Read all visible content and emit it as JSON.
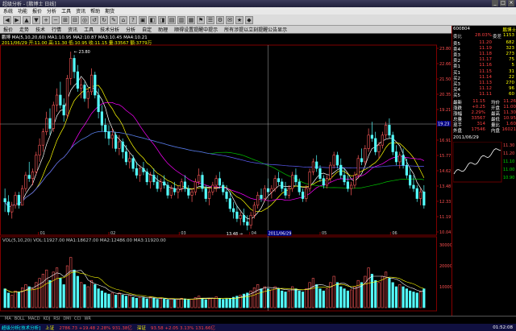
{
  "window": {
    "title": "超级分析 - [鹏博士 日线]"
  },
  "menu": [
    "系统",
    "功能",
    "报价",
    "分析",
    "工具",
    "资讯",
    "帮助",
    "期货"
  ],
  "toolbar2": [
    "报价",
    "走势",
    "技术",
    "行情",
    "资讯",
    "工具",
    "技术分析",
    "分析",
    "自定",
    "助理",
    "顺得设置提醒中提示",
    "所有涉提以立刻提醒公告显示"
  ],
  "stock": {
    "name": "鹏博士",
    "code": "600804"
  },
  "main_info": {
    "line1": "鹏博 MA(5,10,20,60) MA1:10.95 MA2:10.87 MA3:10.45 MA4:10.21",
    "line2": "2011/06/29 开:11.00 高:11.30 低:10.95 收:11.15 量:33567 额:3779万"
  },
  "vol_info": "VOL(5,10,20) VOL:11927.00 MA1:18627.00 MA2:12486.00 MA3:11920.00",
  "price_labels": [
    "22.50",
    "21.00",
    "19.50",
    "18.00",
    "16.50",
    "15.00"
  ],
  "y_axis": [
    "23.80",
    "22.66",
    "21.50",
    "20.35",
    "19.21",
    "18.06",
    "16.91",
    "15.77",
    "14.62",
    "13.48",
    "12.33",
    "11.19",
    "10.04"
  ],
  "vol_axis": [
    "30000",
    "20000",
    "10000"
  ],
  "marks": {
    "high": "23.80",
    "low": "13.48"
  },
  "date_labels": [
    "01",
    "02",
    "03",
    "04",
    "05",
    "06"
  ],
  "crosshair": {
    "date": "2011/06/29",
    "value": "19.23"
  },
  "rpanel": {
    "code": "600804",
    "name": "鹏博士",
    "ratio_label": "委比",
    "ratio": "28.03%",
    "diff_label": "委差",
    "diff": "1153",
    "asks": [
      {
        "l": "卖5",
        "p": "11.20",
        "v": "682"
      },
      {
        "l": "卖4",
        "p": "11.19",
        "v": "323"
      },
      {
        "l": "卖3",
        "p": "11.18",
        "v": "273"
      },
      {
        "l": "卖2",
        "p": "11.17",
        "v": "75"
      },
      {
        "l": "卖1",
        "p": "11.16",
        "v": "5"
      }
    ],
    "bids": [
      {
        "l": "买1",
        "p": "11.15",
        "v": "31"
      },
      {
        "l": "买2",
        "p": "11.14",
        "v": "22"
      },
      {
        "l": "买3",
        "p": "11.13",
        "v": "270"
      },
      {
        "l": "买4",
        "p": "11.12",
        "v": "96"
      },
      {
        "l": "买5",
        "p": "11.11",
        "v": "60"
      }
    ],
    "stats": [
      {
        "a": "最新",
        "b": "11.15",
        "c": "均价",
        "d": "11.26"
      },
      {
        "a": "涨跌",
        "b": "+0.25",
        "c": "开盘",
        "d": "11.00"
      },
      {
        "a": "涨幅",
        "b": "2.29%",
        "c": "最高",
        "d": "11.30"
      },
      {
        "a": "总量",
        "b": "33567",
        "c": "最低",
        "d": "10.95"
      },
      {
        "a": "现手",
        "b": "314",
        "c": "量比",
        "d": "1.60"
      },
      {
        "a": "外盘",
        "b": "17546",
        "c": "内盘",
        "d": "16021"
      }
    ],
    "mini_date": "2011/06/29",
    "mini_values": [
      "11.30",
      "11.20",
      "11.10",
      "11.00",
      "10.90"
    ]
  },
  "tabs": [
    "MA",
    "BOLL",
    "MACD",
    "KDJ",
    "RSI",
    "DMI",
    "CCI",
    "WR"
  ],
  "status": {
    "brand": "超级分析[技术分析]",
    "index1_name": "上证",
    "index1": "2786.73 +19.48 2.28% 931.38亿",
    "index2_name": "深证",
    "index2": "93.58 +2.05 3.13% 131.66亿",
    "time": "01:52:08"
  },
  "colors": {
    "up": "#ff5a5a",
    "down": "#54ffff",
    "ma5": "#ffffff",
    "ma10": "#ffff00",
    "ma20": "#ff00ff",
    "ma60": "#00c000",
    "ma120": "#6060ff"
  },
  "chart_data": {
    "type": "candlestick",
    "candles": [
      [
        15.0,
        15.6,
        14.2,
        14.8
      ],
      [
        14.8,
        15.2,
        14.0,
        14.2
      ],
      [
        14.2,
        14.8,
        13.8,
        14.6
      ],
      [
        14.6,
        15.4,
        14.4,
        15.2
      ],
      [
        15.2,
        15.4,
        14.4,
        14.6
      ],
      [
        14.6,
        15.8,
        14.6,
        15.6
      ],
      [
        15.6,
        16.6,
        15.4,
        16.4
      ],
      [
        16.4,
        17.2,
        16.0,
        16.2
      ],
      [
        16.2,
        16.8,
        15.8,
        16.6
      ],
      [
        16.6,
        17.8,
        16.4,
        17.6
      ],
      [
        17.6,
        18.6,
        17.2,
        18.2
      ],
      [
        18.2,
        19.2,
        17.8,
        19.0
      ],
      [
        19.0,
        20.2,
        18.8,
        19.8
      ],
      [
        19.8,
        20.4,
        18.8,
        19.2
      ],
      [
        19.2,
        20.8,
        19.0,
        20.6
      ],
      [
        20.6,
        21.6,
        20.2,
        21.2
      ],
      [
        21.2,
        22.0,
        20.4,
        20.6
      ],
      [
        20.6,
        21.0,
        19.6,
        20.0
      ],
      [
        20.0,
        22.4,
        19.8,
        22.2
      ],
      [
        22.2,
        23.8,
        21.8,
        23.4
      ],
      [
        23.4,
        23.6,
        22.2,
        22.6
      ],
      [
        22.6,
        23.0,
        21.4,
        21.6
      ],
      [
        21.6,
        22.2,
        21.0,
        21.8
      ],
      [
        21.8,
        22.0,
        20.8,
        21.0
      ],
      [
        21.0,
        21.6,
        20.4,
        21.4
      ],
      [
        21.4,
        22.8,
        21.2,
        22.4
      ],
      [
        22.4,
        22.6,
        21.0,
        21.2
      ],
      [
        21.2,
        21.6,
        19.8,
        20.2
      ],
      [
        20.2,
        20.6,
        19.0,
        19.4
      ],
      [
        19.4,
        19.8,
        18.6,
        19.0
      ],
      [
        19.0,
        19.4,
        18.2,
        18.6
      ],
      [
        18.6,
        19.2,
        18.0,
        18.8
      ],
      [
        18.8,
        19.0,
        17.8,
        18.0
      ],
      [
        18.0,
        18.8,
        17.6,
        18.4
      ],
      [
        18.4,
        18.6,
        17.4,
        17.8
      ],
      [
        17.8,
        18.2,
        17.0,
        17.2
      ],
      [
        17.2,
        17.8,
        16.8,
        17.4
      ],
      [
        17.4,
        17.6,
        16.6,
        16.8
      ],
      [
        16.8,
        17.2,
        16.2,
        16.4
      ],
      [
        16.4,
        17.0,
        16.0,
        16.8
      ],
      [
        16.8,
        17.2,
        16.4,
        16.6
      ],
      [
        16.6,
        16.8,
        15.8,
        16.0
      ],
      [
        16.0,
        16.6,
        15.6,
        16.4
      ],
      [
        16.4,
        16.8,
        15.8,
        16.0
      ],
      [
        16.0,
        16.4,
        15.4,
        15.6
      ],
      [
        15.6,
        16.2,
        15.4,
        16.0
      ],
      [
        16.0,
        16.4,
        15.6,
        15.8
      ],
      [
        15.8,
        16.0,
        15.0,
        15.2
      ],
      [
        15.2,
        15.8,
        15.0,
        15.6
      ],
      [
        15.6,
        16.0,
        15.2,
        15.4
      ],
      [
        15.4,
        15.8,
        15.0,
        15.6
      ],
      [
        15.6,
        16.2,
        15.4,
        16.0
      ],
      [
        16.0,
        16.4,
        15.4,
        15.6
      ],
      [
        15.6,
        15.8,
        15.0,
        15.2
      ],
      [
        15.2,
        15.6,
        14.8,
        15.4
      ],
      [
        15.4,
        16.2,
        15.2,
        16.0
      ],
      [
        16.0,
        16.8,
        15.8,
        16.4
      ],
      [
        16.4,
        16.6,
        15.4,
        15.6
      ],
      [
        15.6,
        15.8,
        14.8,
        15.0
      ],
      [
        15.0,
        15.6,
        14.6,
        15.4
      ],
      [
        15.4,
        16.0,
        15.2,
        15.8
      ],
      [
        15.8,
        16.4,
        15.4,
        16.2
      ],
      [
        16.2,
        16.6,
        15.6,
        15.8
      ],
      [
        15.8,
        16.0,
        15.2,
        15.4
      ],
      [
        15.4,
        15.8,
        14.8,
        15.0
      ],
      [
        15.0,
        15.4,
        14.2,
        14.4
      ],
      [
        14.4,
        14.8,
        13.8,
        14.2
      ],
      [
        14.2,
        14.6,
        13.6,
        13.8
      ],
      [
        13.8,
        14.2,
        13.4,
        14.0
      ],
      [
        14.0,
        14.4,
        13.4,
        13.6
      ],
      [
        13.6,
        14.0,
        13.1,
        13.4
      ],
      [
        13.4,
        14.2,
        13.2,
        14.0
      ],
      [
        14.0,
        14.8,
        13.8,
        14.6
      ],
      [
        14.6,
        15.4,
        14.4,
        15.2
      ],
      [
        15.2,
        15.6,
        14.8,
        15.0
      ],
      [
        15.0,
        15.8,
        14.8,
        15.6
      ],
      [
        15.6,
        16.2,
        15.2,
        15.4
      ],
      [
        15.4,
        15.8,
        15.0,
        15.6
      ],
      [
        15.6,
        16.4,
        15.4,
        16.2
      ],
      [
        16.2,
        16.6,
        15.8,
        16.0
      ],
      [
        16.0,
        16.2,
        15.4,
        15.6
      ],
      [
        15.6,
        16.0,
        15.0,
        15.2
      ],
      [
        15.2,
        15.8,
        15.0,
        15.6
      ],
      [
        15.6,
        16.6,
        15.4,
        16.4
      ],
      [
        16.4,
        16.8,
        15.8,
        16.0
      ],
      [
        16.0,
        16.2,
        15.2,
        15.4
      ],
      [
        15.4,
        15.6,
        14.8,
        15.0
      ],
      [
        15.0,
        15.8,
        14.8,
        15.6
      ],
      [
        15.6,
        16.8,
        15.4,
        16.6
      ],
      [
        16.6,
        17.4,
        16.4,
        17.2
      ],
      [
        17.2,
        17.6,
        16.6,
        16.8
      ],
      [
        16.8,
        17.0,
        16.0,
        16.2
      ],
      [
        16.2,
        16.4,
        15.6,
        15.8
      ],
      [
        15.8,
        16.4,
        15.6,
        16.2
      ],
      [
        16.2,
        17.2,
        16.0,
        17.0
      ],
      [
        17.0,
        17.8,
        16.8,
        17.6
      ],
      [
        17.6,
        17.8,
        16.8,
        17.0
      ],
      [
        17.0,
        17.4,
        16.2,
        16.4
      ],
      [
        16.4,
        16.8,
        15.8,
        16.0
      ],
      [
        16.0,
        16.4,
        15.4,
        15.6
      ],
      [
        15.6,
        16.0,
        15.2,
        15.8
      ],
      [
        15.8,
        16.6,
        15.6,
        16.4
      ],
      [
        16.4,
        17.6,
        16.2,
        17.4
      ],
      [
        17.4,
        18.0,
        17.0,
        17.2
      ],
      [
        17.2,
        18.2,
        17.0,
        18.0
      ],
      [
        18.0,
        19.2,
        17.8,
        18.8
      ],
      [
        18.8,
        19.6,
        18.4,
        18.6
      ],
      [
        18.6,
        19.0,
        17.6,
        17.8
      ],
      [
        17.8,
        18.4,
        17.4,
        18.2
      ],
      [
        18.2,
        19.0,
        18.0,
        18.8
      ],
      [
        18.8,
        19.6,
        18.6,
        19.4
      ],
      [
        19.4,
        19.8,
        18.6,
        18.8
      ],
      [
        18.8,
        19.0,
        17.6,
        17.8
      ],
      [
        17.8,
        18.2,
        17.0,
        17.2
      ],
      [
        17.2,
        17.8,
        16.8,
        17.6
      ],
      [
        17.6,
        18.0,
        16.8,
        17.0
      ],
      [
        17.0,
        17.4,
        16.2,
        16.4
      ],
      [
        16.4,
        16.8,
        15.6,
        15.8
      ],
      [
        15.8,
        16.4,
        15.4,
        15.6
      ],
      [
        15.6,
        15.8,
        14.8,
        15.0
      ],
      [
        15.0,
        15.6,
        14.6,
        15.4
      ],
      [
        15.4,
        15.8,
        14.4,
        14.6
      ]
    ],
    "volumes": [
      9000,
      7000,
      6000,
      8000,
      7500,
      9500,
      11000,
      10000,
      9000,
      12000,
      14000,
      16000,
      18000,
      13000,
      17000,
      19000,
      14000,
      11000,
      20000,
      24000,
      18000,
      15000,
      12000,
      11000,
      10000,
      13000,
      11000,
      9000,
      8000,
      7000,
      6500,
      7000,
      6000,
      7000,
      6000,
      5500,
      6000,
      5000,
      4500,
      5000,
      4800,
      4200,
      5000,
      4500,
      4000,
      4500,
      4200,
      3800,
      4200,
      3800,
      4000,
      4500,
      4200,
      3800,
      4000,
      4800,
      5500,
      4500,
      3800,
      4200,
      4600,
      5200,
      4500,
      4000,
      4200,
      4500,
      5000,
      5500,
      6000,
      6500,
      7000,
      8000,
      9500,
      11000,
      9000,
      10000,
      9000,
      8500,
      10000,
      9000,
      8000,
      7500,
      8000,
      10000,
      9000,
      8000,
      7500,
      9000,
      12000,
      14000,
      11000,
      9000,
      8000,
      9000,
      12000,
      15000,
      12000,
      10000,
      9000,
      8000,
      8500,
      10000,
      13000,
      12000,
      15000,
      19000,
      16000,
      13000,
      12000,
      15000,
      17000,
      14000,
      12000,
      10000,
      11000,
      10000,
      9000,
      8000,
      7500,
      7000,
      7500,
      9000
    ],
    "ylim": [
      13.0,
      24.0
    ],
    "vol_max": 30000
  }
}
